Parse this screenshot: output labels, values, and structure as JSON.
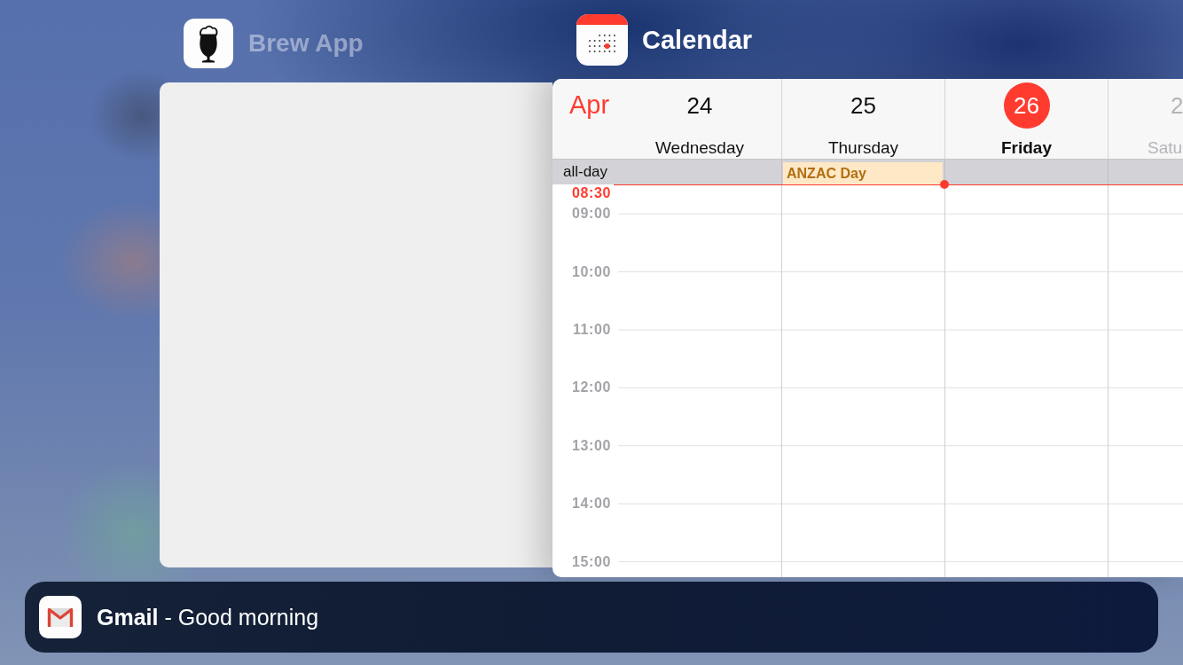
{
  "apps": [
    {
      "kind": "brew",
      "name": "Brew App",
      "dimmed": true
    },
    {
      "kind": "calendar",
      "name": "Calendar",
      "dimmed": false,
      "calendar": {
        "month": "Apr",
        "all_day_label": "all-day",
        "days": [
          {
            "number": "24",
            "name": "Wednesday",
            "today": false,
            "weekend": false
          },
          {
            "number": "25",
            "name": "Thursday",
            "today": false,
            "weekend": false,
            "all_day": [
              "ANZAC Day"
            ]
          },
          {
            "number": "26",
            "name": "Friday",
            "today": true,
            "weekend": false
          },
          {
            "number": "2",
            "name": "Satu",
            "today": false,
            "weekend": true
          }
        ],
        "current_time": "08:30",
        "hours": [
          "09:00",
          "10:00",
          "11:00",
          "12:00",
          "13:00",
          "14:00",
          "15:00"
        ]
      }
    }
  ],
  "notification": {
    "text": "**Gmail** - Good morning"
  }
}
